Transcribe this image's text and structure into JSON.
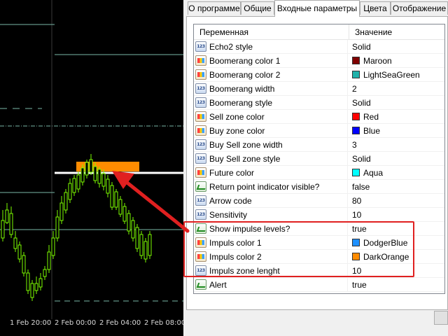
{
  "chart": {
    "x_labels": [
      "1 Feb 20:00",
      "2 Feb 00:00",
      "2 Feb 04:00",
      "2 Feb 08:00"
    ],
    "colors": {
      "background": "#000000",
      "candle": "#7cfc00",
      "level_line": "#ffffff",
      "zone": "#ff8c00",
      "guide_line": "#7ab8a8",
      "arrow": "#e02020"
    }
  },
  "tabs": [
    {
      "label": "О программе"
    },
    {
      "label": "Общие"
    },
    {
      "label": "Входные параметры"
    },
    {
      "label": "Цвета"
    },
    {
      "label": "Отображение"
    }
  ],
  "grid": {
    "header_variable": "Переменная",
    "header_value": "Значение",
    "rows": [
      {
        "name": "Echo2 style",
        "value": "Solid",
        "icon": "number-icon"
      },
      {
        "name": "Boomerang color 1",
        "value": "Maroon",
        "icon": "color-icon",
        "swatch": "#800000"
      },
      {
        "name": "Boomerang color 2",
        "value": "LightSeaGreen",
        "icon": "color-icon",
        "swatch": "#20b2aa"
      },
      {
        "name": "Boomerang width",
        "value": "2",
        "icon": "number-icon"
      },
      {
        "name": "Boomerang style",
        "value": "Solid",
        "icon": "number-icon"
      },
      {
        "name": "Sell zone color",
        "value": "Red",
        "icon": "color-icon",
        "swatch": "#ff0000"
      },
      {
        "name": "Buy zone color",
        "value": "Blue",
        "icon": "color-icon",
        "swatch": "#0000ff"
      },
      {
        "name": "Buy Sell zone width",
        "value": "3",
        "icon": "number-icon"
      },
      {
        "name": "Buy Sell zone style",
        "value": "Solid",
        "icon": "number-icon"
      },
      {
        "name": "Future color",
        "value": "Aqua",
        "icon": "color-icon",
        "swatch": "#00ffff"
      },
      {
        "name": "Return point indicator visible?",
        "value": "false",
        "icon": "bool-icon"
      },
      {
        "name": "Arrow code",
        "value": "80",
        "icon": "number-icon"
      },
      {
        "name": "Sensitivity",
        "value": "10",
        "icon": "number-icon"
      },
      {
        "name": "Show impulse levels?",
        "value": "true",
        "icon": "bool-icon"
      },
      {
        "name": "Impuls color 1",
        "value": "DodgerBlue",
        "icon": "color-icon",
        "swatch": "#1e90ff"
      },
      {
        "name": "Impuls color 2",
        "value": "DarkOrange",
        "icon": "color-icon",
        "swatch": "#ff8c00"
      },
      {
        "name": "Impuls zone lenght",
        "value": "10",
        "icon": "number-icon"
      },
      {
        "name": "Alert",
        "value": "true",
        "icon": "bool-icon"
      }
    ]
  }
}
